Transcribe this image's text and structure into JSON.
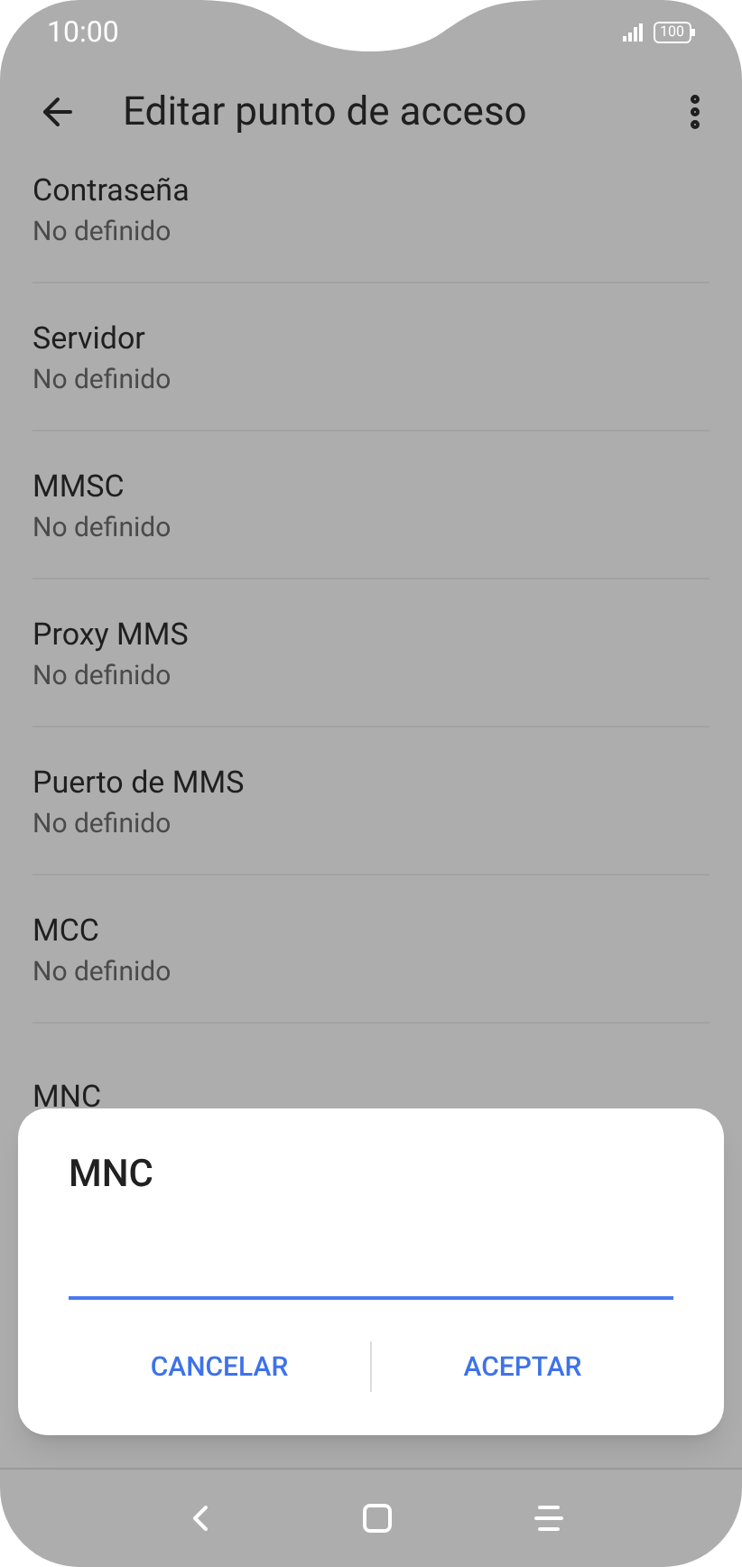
{
  "status_bar": {
    "time": "10:00",
    "battery": "100"
  },
  "header": {
    "title": "Editar punto de acceso"
  },
  "settings": [
    {
      "title": "Contraseña",
      "value": "No definido"
    },
    {
      "title": "Servidor",
      "value": "No definido"
    },
    {
      "title": "MMSC",
      "value": "No definido"
    },
    {
      "title": "Proxy MMS",
      "value": "No definido"
    },
    {
      "title": "Puerto de MMS",
      "value": "No definido"
    },
    {
      "title": "MCC",
      "value": "No definido"
    },
    {
      "title": "MNC"
    }
  ],
  "dialog": {
    "title": "MNC",
    "buttons": [
      "CANCELAR",
      "ACEPTAR"
    ]
  }
}
